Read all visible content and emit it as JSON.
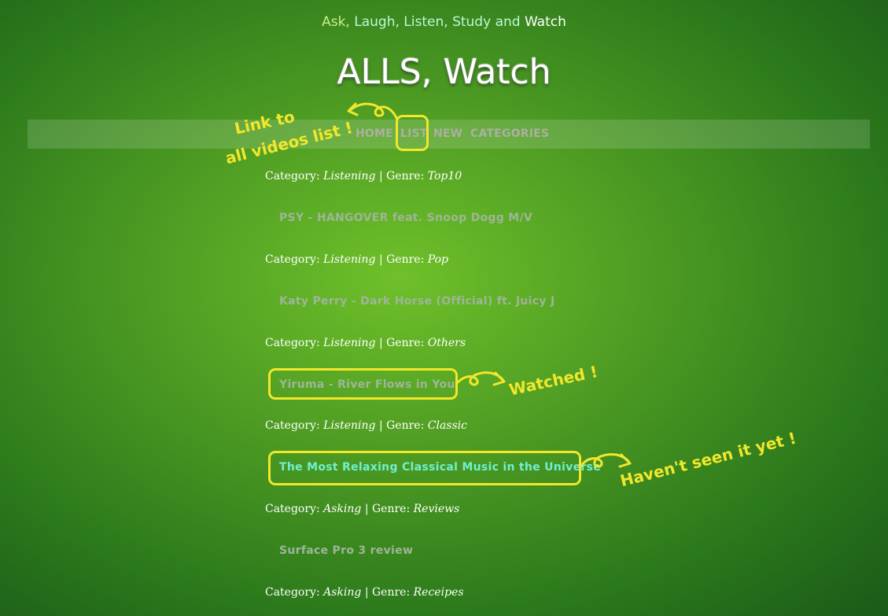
{
  "header": {
    "tagline_words": [
      "Ask,",
      "Laugh,",
      "Listen,",
      "Study",
      "and",
      "Watch"
    ],
    "title": "ALLS, Watch"
  },
  "nav": {
    "items": [
      {
        "label": "HOME"
      },
      {
        "label": "LIST"
      },
      {
        "label": "NEW"
      },
      {
        "label": "CATEGORIES"
      }
    ]
  },
  "entries": [
    {
      "category_label": "Category:",
      "category": "Listening",
      "sep": "| Genre:",
      "genre": "Top10",
      "title": "PSY - HANGOVER feat. Snoop Dogg M/V"
    },
    {
      "category_label": "Category:",
      "category": "Listening",
      "sep": "| Genre:",
      "genre": "Pop",
      "title": "Katy Perry - Dark Horse (Official) ft. Juicy J"
    },
    {
      "category_label": "Category:",
      "category": "Listening",
      "sep": "| Genre:",
      "genre": "Others",
      "title": "Yiruma - River Flows in You"
    },
    {
      "category_label": "Category:",
      "category": "Listening",
      "sep": "| Genre:",
      "genre": "Classic",
      "title": "The Most Relaxing Classical Music in the Universe"
    },
    {
      "category_label": "Category:",
      "category": "Asking",
      "sep": "| Genre:",
      "genre": "Reviews",
      "title": "Surface Pro 3 review"
    },
    {
      "category_label": "Category:",
      "category": "Asking",
      "sep": "| Genre:",
      "genre": "Receipes"
    }
  ],
  "annotations": {
    "list_link_line1": "Link to",
    "list_link_line2": "all videos list !",
    "watched": "Watched !",
    "unseen": "Haven't seen it yet !"
  },
  "colors": {
    "accent_annotation": "#f2e72b",
    "visited_link": "#9fb59a",
    "unvisited_link": "#6ff0d0"
  }
}
